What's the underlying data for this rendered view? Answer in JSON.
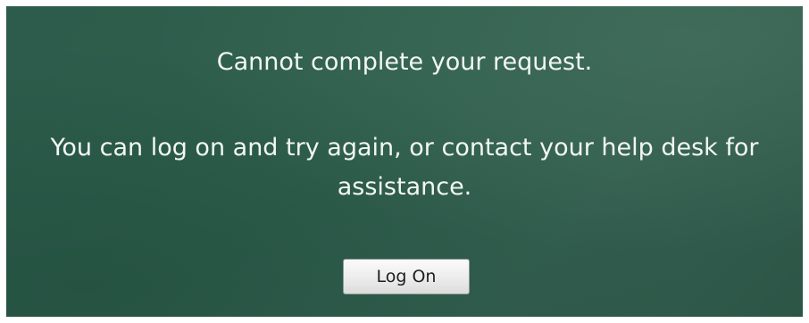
{
  "dialog": {
    "heading": "Cannot complete your request.",
    "message_line1": "You can log on and try again, or contact your help desk for",
    "message_line2": "assistance.",
    "logon_label": "Log On"
  },
  "colors": {
    "background": "#2f5e4d",
    "text": "#f2f7f4",
    "button_face": "#ececec"
  }
}
